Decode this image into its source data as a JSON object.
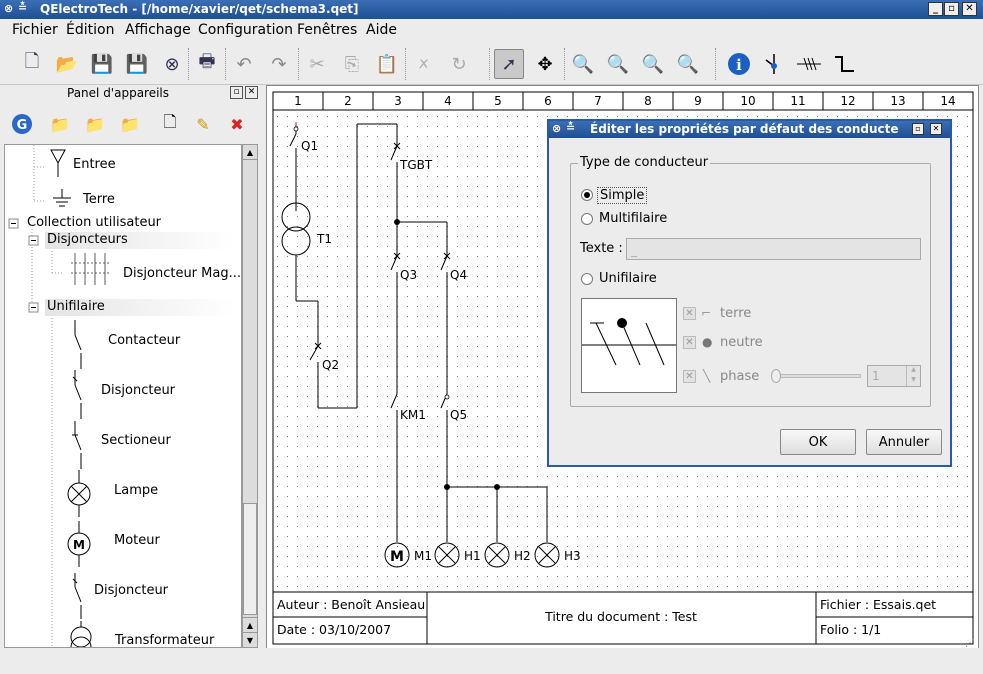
{
  "window": {
    "title": "QElectroTech - [/home/xavier/qet/schema3.qet]",
    "controls": [
      "_",
      "▫",
      "✕"
    ]
  },
  "menu": [
    "Fichier",
    "Édition",
    "Affichage",
    "Configuration",
    "Fenêtres",
    "Aide"
  ],
  "toolbar": {
    "icons": [
      "new-file-icon",
      "open-folder-icon",
      "save-icon",
      "save-as-icon",
      "close-icon",
      "print-icon",
      "undo-icon",
      "redo-icon",
      "cut-icon",
      "copy-icon",
      "paste-icon",
      "delete-icon",
      "rotate-icon",
      "select-pointer-icon",
      "move-icon",
      "zoom-in-icon",
      "zoom-out-icon",
      "zoom-fit-icon",
      "zoom-reset-icon",
      "info-icon",
      "add-junction-icon",
      "conductor-icon",
      "route-icon"
    ]
  },
  "panel": {
    "title": "Panel d'appareils",
    "items": {
      "entree": "Entree",
      "terre": "Terre",
      "collection": "Collection utilisateur",
      "disjoncteurs": "Disjoncteurs",
      "disjoncteur_mag": "Disjoncteur Mag...",
      "unifilaire": "Unifilaire",
      "contacteur": "Contacteur",
      "disjoncteur": "Disjoncteur",
      "sectioneur": "Sectioneur",
      "lampe": "Lampe",
      "moteur": "Moteur",
      "disjoncteur2": "Disjoncteur",
      "transformateur": "Transformateur"
    }
  },
  "schema": {
    "columns": [
      "1",
      "2",
      "3",
      "4",
      "5",
      "6",
      "7",
      "8",
      "9",
      "10",
      "11",
      "12",
      "13",
      "14"
    ],
    "labels": {
      "q1": "Q1",
      "t1": "T1",
      "q2": "Q2",
      "tgbt": "TGBT",
      "q3": "Q3",
      "q4": "Q4",
      "km1": "KM1",
      "q5": "Q5",
      "m1": "M1",
      "h1": "H1",
      "h2": "H2",
      "h3": "H3",
      "m_symbol": "M"
    },
    "cartouche": {
      "auteur": "Auteur : Benoît Ansieau",
      "date": "Date : 03/10/2007",
      "titre": "Titre du document : Test",
      "fichier": "Fichier : Essais.qet",
      "folio": "Folio : 1/1"
    }
  },
  "dialog": {
    "title": "Éditer les propriétés par défaut des conducte",
    "group_title": "Type de conducteur",
    "options": {
      "simple": "Simple",
      "multifilaire": "Multifilaire",
      "unifilaire": "Unifilaire"
    },
    "selected": "Simple",
    "texte_label": "Texte :",
    "texte_value": "_",
    "checks": {
      "terre": "terre",
      "neutre": "neutre",
      "phase": "phase"
    },
    "phase_count": "1",
    "ok": "OK",
    "cancel": "Annuler"
  },
  "colors": {
    "titlebar": "#2a5aa0",
    "accent": "#1f4f95"
  }
}
